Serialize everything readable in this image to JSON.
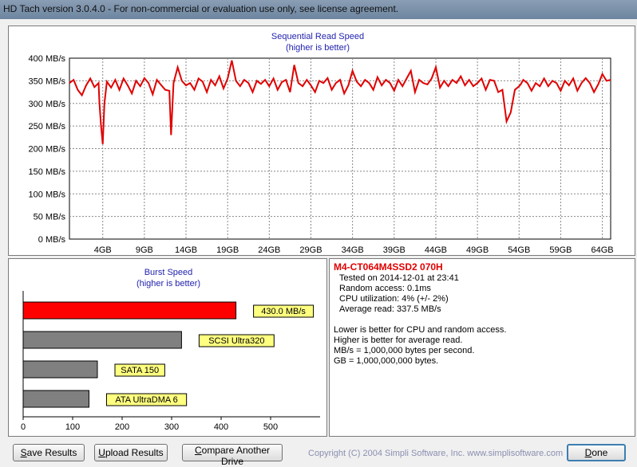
{
  "window": {
    "title": "HD Tach version 3.0.4.0  - For non-commercial or evaluation use only, see license agreement."
  },
  "sequential": {
    "title": "Sequential Read Speed",
    "subtitle": "(higher is better)",
    "y_ticks": [
      "400 MB/s",
      "350 MB/s",
      "300 MB/s",
      "250 MB/s",
      "200 MB/s",
      "150 MB/s",
      "100 MB/s",
      "50 MB/s",
      "0 MB/s"
    ],
    "x_ticks": [
      "4GB",
      "9GB",
      "14GB",
      "19GB",
      "24GB",
      "29GB",
      "34GB",
      "39GB",
      "44GB",
      "49GB",
      "54GB",
      "59GB",
      "64GB"
    ]
  },
  "burst": {
    "title": "Burst Speed",
    "subtitle": "(higher is better)",
    "x_ticks": [
      "0",
      "100",
      "200",
      "300",
      "400",
      "500"
    ]
  },
  "chart_data": [
    {
      "type": "line",
      "title": "Sequential Read Speed",
      "subtitle": "(higher is better)",
      "xlabel": "",
      "ylabel": "",
      "xlim": [
        0,
        65
      ],
      "ylim": [
        0,
        400
      ],
      "x_unit": "GB",
      "y_unit": "MB/s",
      "grid": true,
      "series": [
        {
          "color": "#e00000",
          "x": [
            0,
            0.5,
            1,
            1.5,
            2,
            2.5,
            3,
            3.5,
            3.6,
            3.8,
            4,
            4.2,
            4.5,
            5,
            5.5,
            6,
            6.5,
            7,
            7.5,
            8,
            8.5,
            9,
            9.5,
            10,
            10.5,
            11,
            11.5,
            12,
            12.2,
            12.5,
            13,
            13.5,
            14,
            14.5,
            15,
            15.5,
            16,
            16.5,
            17,
            17.5,
            18,
            18.5,
            19,
            19.5,
            20,
            20.5,
            21,
            21.5,
            22,
            22.5,
            23,
            23.5,
            24,
            24.5,
            25,
            25.5,
            26,
            26.5,
            27,
            27.5,
            28,
            28.5,
            29,
            29.5,
            30,
            30.5,
            31,
            31.5,
            32,
            32.5,
            33,
            33.5,
            34,
            34.5,
            35,
            35.5,
            36,
            36.5,
            37,
            37.5,
            38,
            38.5,
            39,
            39.5,
            40,
            40.5,
            41,
            41.5,
            42,
            42.5,
            43,
            43.5,
            44,
            44.5,
            45,
            45.5,
            46,
            46.5,
            47,
            47.5,
            48,
            48.5,
            49,
            49.5,
            50,
            50.5,
            51,
            51.5,
            52,
            52.5,
            53,
            53.5,
            54,
            54.2,
            54.5,
            55,
            55.5,
            56,
            56.5,
            57,
            57.5,
            58,
            58.5,
            59,
            59.5,
            60,
            60.5,
            61,
            61.5,
            62,
            62.5,
            63,
            63.5,
            64,
            64.5,
            65
          ],
          "values": [
            345,
            352,
            330,
            318,
            340,
            355,
            336,
            345,
            300,
            250,
            210,
            300,
            348,
            335,
            352,
            330,
            355,
            340,
            322,
            350,
            338,
            356,
            345,
            320,
            352,
            341,
            330,
            328,
            230,
            345,
            380,
            350,
            340,
            345,
            330,
            355,
            348,
            325,
            352,
            340,
            360,
            333,
            355,
            395,
            350,
            338,
            352,
            345,
            325,
            350,
            343,
            352,
            338,
            355,
            330,
            347,
            352,
            325,
            385,
            345,
            338,
            352,
            340,
            325,
            350,
            345,
            356,
            330,
            345,
            352,
            322,
            340,
            372,
            348,
            338,
            352,
            345,
            330,
            358,
            340,
            352,
            345,
            328,
            352,
            338,
            355,
            372,
            325,
            352,
            345,
            342,
            355,
            380,
            335,
            350,
            338,
            352,
            345,
            360,
            340,
            352,
            338,
            345,
            355,
            330,
            352,
            350,
            325,
            330,
            260,
            280,
            330,
            338,
            342,
            352,
            345,
            328,
            345,
            338,
            355,
            338,
            350,
            345,
            328,
            350,
            340,
            355,
            328,
            345,
            356,
            345,
            325,
            342,
            365,
            350,
            352
          ]
        }
      ]
    },
    {
      "type": "bar",
      "title": "Burst Speed",
      "subtitle": "(higher is better)",
      "xlim": [
        0,
        600
      ],
      "categories": [
        "430.0 MB/s",
        "SCSI Ultra320",
        "SATA 150",
        "ATA UltraDMA 6"
      ],
      "values": [
        430,
        320,
        150,
        133
      ],
      "colors": [
        "#ff0000",
        "#808080",
        "#808080",
        "#808080"
      ],
      "label_bg": "#ffff80"
    }
  ],
  "info": {
    "drive": "M4-CT064M4SSD2 070H",
    "tested": "Tested on 2014-12-01 at 23:41",
    "random_access": "Random access: 0.1ms",
    "cpu": "CPU utilization: 4% (+/- 2%)",
    "avg_read": "Average read: 337.5 MB/s",
    "note1": "Lower is better for CPU and random access.",
    "note2": "Higher is better for average read.",
    "note3": "MB/s = 1,000,000 bytes per second.",
    "note4": "GB = 1,000,000,000 bytes."
  },
  "buttons": {
    "save_u": "S",
    "save_rest": "ave Results",
    "upload_u": "U",
    "upload_rest": "pload Results",
    "compare_u": "C",
    "compare_rest": "ompare Another Drive",
    "done_u": "D",
    "done_rest": "one"
  },
  "footer": {
    "copyright": "Copyright (C) 2004 Simpli Software, Inc. www.simplisoftware.com"
  }
}
